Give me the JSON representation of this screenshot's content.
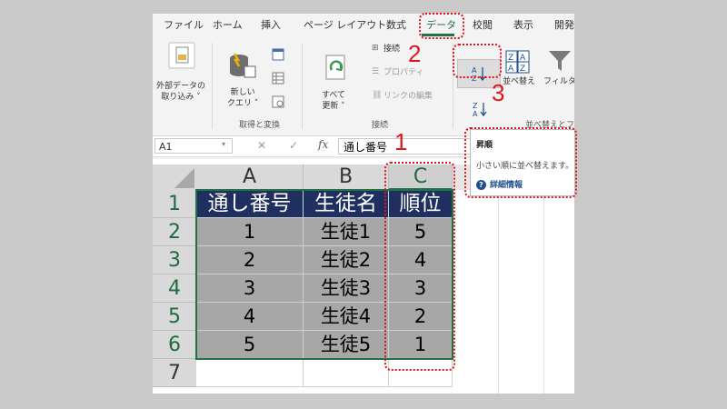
{
  "ribbon_tabs": [
    "ファイル",
    "ホーム",
    "挿入",
    "ページ レイアウト",
    "数式",
    "データ",
    "校閲",
    "表示",
    "開発"
  ],
  "active_tab": "データ",
  "ribbon": {
    "external_data": "外部データの\n取り込み ˅",
    "new_query": "新しい\nクエリ ˅",
    "refresh_all": "すべて\n更新 ˅",
    "connections": "接続",
    "properties": "プロパティ",
    "edit_links": "リンクの編集",
    "sort": "並べ替え",
    "filter": "フィルター",
    "group_get_transform": "取得と変換",
    "group_connections": "接続",
    "group_sort_filter": "並べ替えとフィ"
  },
  "formula_bar": {
    "name_box": "A1",
    "fx": "fx",
    "content": "通し番号"
  },
  "columns": [
    "A",
    "B",
    "C"
  ],
  "row_numbers": [
    "1",
    "2",
    "3",
    "4",
    "5",
    "6",
    "7"
  ],
  "table": {
    "headers": [
      "通し番号",
      "生徒名",
      "順位"
    ],
    "rows": [
      [
        "1",
        "生徒1",
        "5"
      ],
      [
        "2",
        "生徒2",
        "4"
      ],
      [
        "3",
        "生徒3",
        "3"
      ],
      [
        "4",
        "生徒4",
        "2"
      ],
      [
        "5",
        "生徒5",
        "1"
      ]
    ]
  },
  "tooltip": {
    "title": "昇順",
    "description": "小さい順に並べ替えます。",
    "more_info": "詳細情報"
  },
  "steps": [
    "1",
    "2",
    "3"
  ],
  "colors": {
    "accent_green": "#217346",
    "header_fill": "#1f2f5f",
    "annotation_red": "#e0161e"
  }
}
